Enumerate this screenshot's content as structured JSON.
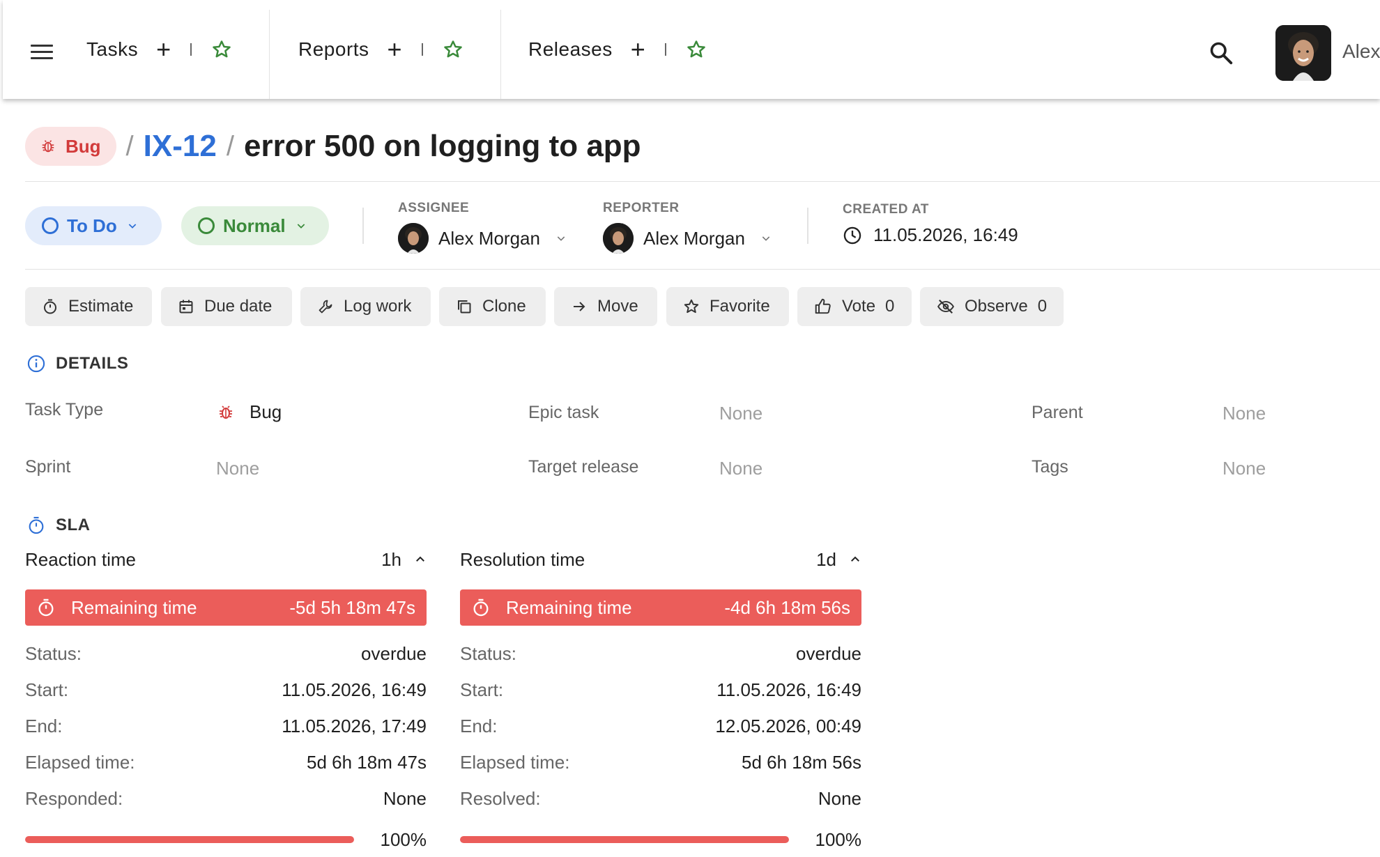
{
  "nav": {
    "items": [
      {
        "label": "Tasks"
      },
      {
        "label": "Reports"
      },
      {
        "label": "Releases"
      }
    ],
    "user_name": "Alex"
  },
  "issue": {
    "type_label": "Bug",
    "key": "IX-12",
    "title": "error 500 on logging to app",
    "separator": "/"
  },
  "status": {
    "label": "To Do"
  },
  "priority": {
    "label": "Normal"
  },
  "assignee": {
    "label": "ASSIGNEE",
    "name": "Alex Morgan"
  },
  "reporter": {
    "label": "REPORTER",
    "name": "Alex Morgan"
  },
  "created": {
    "label": "CREATED AT",
    "value": "11.05.2026, 16:49"
  },
  "actions": {
    "estimate": "Estimate",
    "due_date": "Due date",
    "log_work": "Log work",
    "clone": "Clone",
    "move": "Move",
    "favorite": "Favorite",
    "vote": "Vote",
    "vote_count": "0",
    "observe": "Observe",
    "observe_count": "0"
  },
  "details": {
    "heading": "DETAILS",
    "task_type_label": "Task Type",
    "task_type_value": "Bug",
    "epic_label": "Epic task",
    "epic_value": "None",
    "parent_label": "Parent",
    "parent_value": "None",
    "sprint_label": "Sprint",
    "sprint_value": "None",
    "release_label": "Target release",
    "release_value": "None",
    "tags_label": "Tags",
    "tags_value": "None"
  },
  "sla": {
    "heading": "SLA",
    "reaction": {
      "title": "Reaction time",
      "target": "1h",
      "remaining_label": "Remaining time",
      "remaining_value": "-5d 5h 18m 47s",
      "status_label": "Status:",
      "status_value": "overdue",
      "start_label": "Start:",
      "start_value": "11.05.2026, 16:49",
      "end_label": "End:",
      "end_value": "11.05.2026, 17:49",
      "elapsed_label": "Elapsed time:",
      "elapsed_value": "5d 6h 18m 47s",
      "done_label": "Responded:",
      "done_value": "None",
      "progress": 100,
      "progress_label": "100%"
    },
    "resolution": {
      "title": "Resolution time",
      "target": "1d",
      "remaining_label": "Remaining time",
      "remaining_value": "-4d 6h 18m 56s",
      "status_label": "Status:",
      "status_value": "overdue",
      "start_label": "Start:",
      "start_value": "11.05.2026, 16:49",
      "end_label": "End:",
      "end_value": "12.05.2026, 00:49",
      "elapsed_label": "Elapsed time:",
      "elapsed_value": "5d 6h 18m 56s",
      "done_label": "Resolved:",
      "done_value": "None",
      "progress": 100,
      "progress_label": "100%"
    }
  },
  "colors": {
    "accent_blue": "#2e6fd6",
    "bug_red": "#d23a3a",
    "sla_red": "#eb5d5a",
    "star_green": "#3a8a3a"
  }
}
